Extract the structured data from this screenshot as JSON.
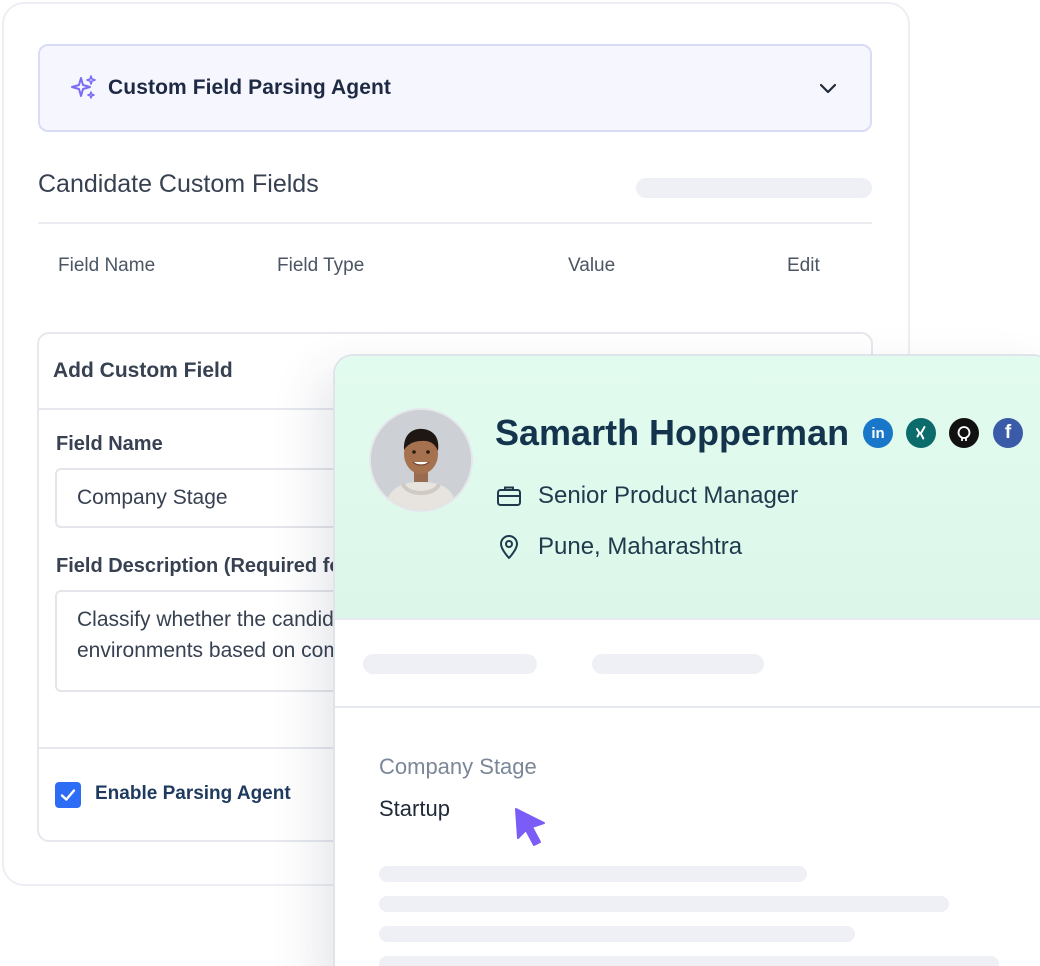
{
  "agent": {
    "title": "Custom Field Parsing Agent",
    "sparkle_icon": "sparkle-icon",
    "chevron_icon": "chevron-down-icon",
    "accent": "#7b6cf6"
  },
  "section": {
    "title": "Candidate Custom Fields"
  },
  "table": {
    "columns": [
      "Field Name",
      "Field Type",
      "Value",
      "Edit"
    ]
  },
  "add_field": {
    "title": "Add Custom Field",
    "field_name_label": "Field Name",
    "field_name_value": "Company Stage",
    "description_label": "Field Description (Required for parsing)",
    "description_value": "Classify whether the candidate has worked in startup\nenvironments based on company details",
    "enable_label": "Enable Parsing Agent",
    "enable_checked": true,
    "check_color": "#2d6df6"
  },
  "profile": {
    "name": "Samarth Hopperman",
    "title": "Senior Product Manager",
    "location": "Pune, Maharashtra",
    "socials": [
      {
        "icon": "linkedin-icon",
        "glyph": "in",
        "color": "#1877c9"
      },
      {
        "icon": "xing-icon",
        "glyph": "X",
        "color": "#0c6b6b"
      },
      {
        "icon": "github-icon",
        "glyph": "",
        "color": "#111111"
      },
      {
        "icon": "facebook-icon",
        "glyph": "f",
        "color": "#3b5ba8"
      }
    ],
    "header_color": "#e2fbef",
    "field_label": "Company Stage",
    "field_value": "Startup",
    "cursor_color": "#7b5cf6"
  }
}
